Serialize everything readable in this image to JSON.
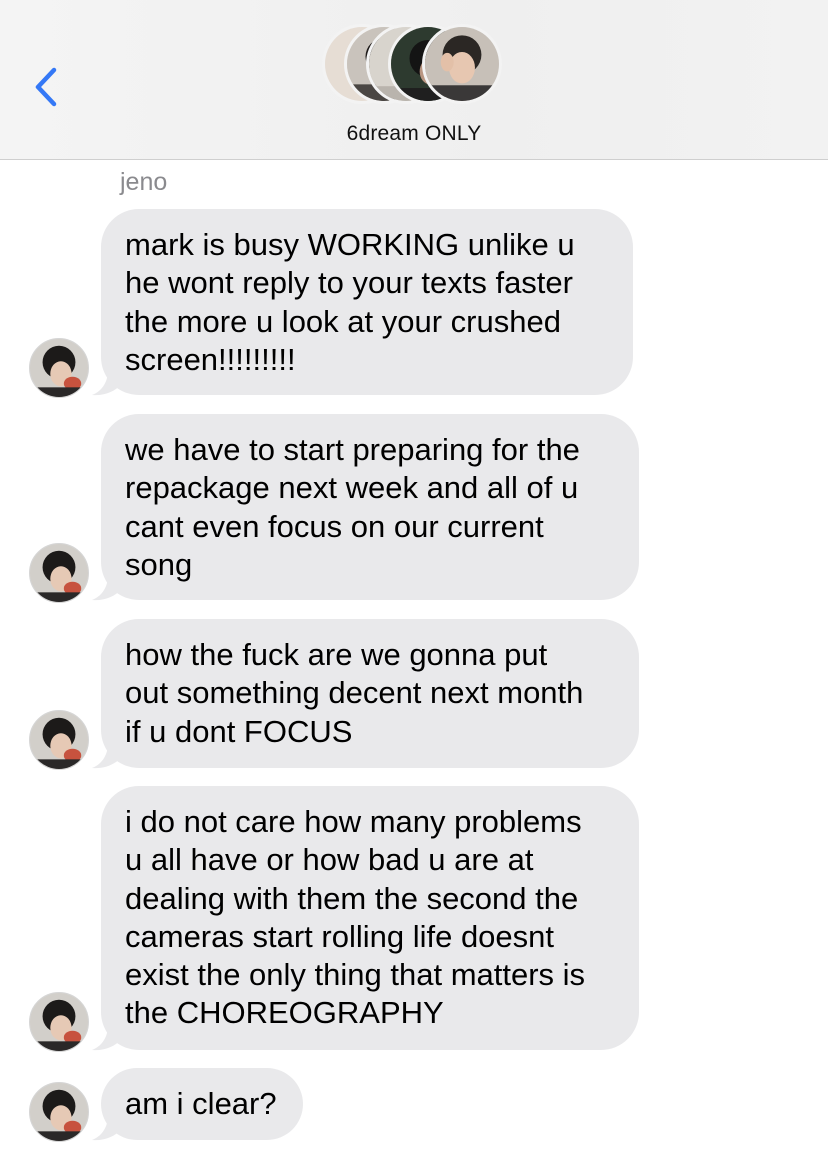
{
  "header": {
    "group_name": "6dream ONLY",
    "back_icon": "chevron-left-icon",
    "accent_color": "#3478f6"
  },
  "conversation": {
    "sender_name": "jeno",
    "bubble_color": "#e9e9eb",
    "messages": [
      {
        "lines": [
          "mark is busy WORKING unlike u",
          "he wont reply to your texts faster",
          "the more u look at your crushed",
          "screen!!!!!!!!!"
        ]
      },
      {
        "lines": [
          "we have to start preparing for the",
          "repackage next week and all of u",
          "cant even focus on our current",
          "song"
        ]
      },
      {
        "lines": [
          "how the fuck are we gonna put",
          "out something decent next month",
          "if u dont FOCUS"
        ]
      },
      {
        "lines": [
          "i do not care how many problems",
          "u all have or how bad u are at",
          "dealing with them the second the",
          "cameras start rolling life doesnt",
          "exist the only thing that matters is",
          "the CHOREOGRAPHY"
        ]
      },
      {
        "lines": [
          "am i clear?"
        ]
      }
    ]
  }
}
